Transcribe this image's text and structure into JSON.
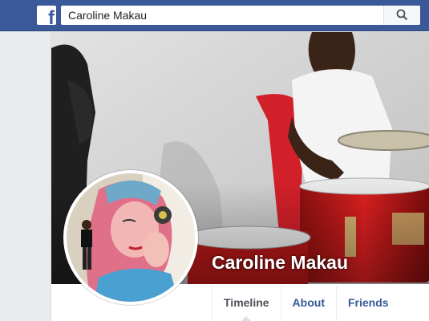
{
  "brand": {
    "logo_letter": "f",
    "color": "#3b5998"
  },
  "search": {
    "value": "Caroline Makau",
    "button_icon": "search-icon"
  },
  "profile": {
    "name": "Caroline Makau"
  },
  "tabs": [
    {
      "label": "Timeline"
    },
    {
      "label": "About"
    },
    {
      "label": "Friends"
    }
  ]
}
